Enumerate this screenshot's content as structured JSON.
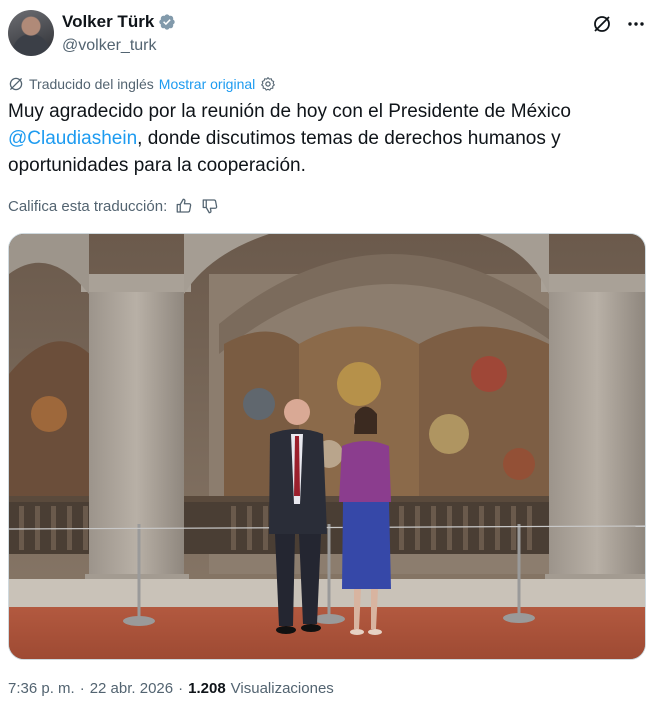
{
  "author": {
    "display_name": "Volker Türk",
    "handle": "@volker_turk"
  },
  "translation": {
    "status": "Traducido del inglés",
    "show_original": "Mostrar original"
  },
  "tweet": {
    "text_part1": "Muy agradecido por la reunión de hoy con el Presidente de México ",
    "mention": "@Claudiashein",
    "text_part2": ", donde discutimos temas de derechos humanos y oportunidades para la cooperación."
  },
  "rating": {
    "label": "Califica esta traducción:"
  },
  "meta": {
    "time": "7:36 p. m.",
    "separator": "·",
    "date": "22 abr. 2026",
    "views_count": "1.208",
    "views_label": "Visualizaciones"
  },
  "colors": {
    "link": "#1d9bf0",
    "verified": "#829aab",
    "muted": "#536471"
  },
  "icons": [
    "verified-badge-icon",
    "grok-icon",
    "more-icon",
    "translate-icon",
    "settings-icon",
    "thumbs-up-icon",
    "thumbs-down-icon"
  ]
}
